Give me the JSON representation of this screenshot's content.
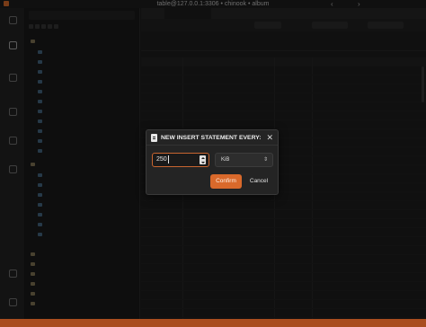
{
  "window": {
    "title": "table@127.0.0.1:3306 • chinook • album",
    "nav_back": "‹",
    "nav_forward": "›"
  },
  "dialog": {
    "title": "NEW INSERT STATEMENT EVERY:",
    "close_glyph": "✕",
    "value": "250",
    "unit": "KiB",
    "confirm_label": "Confirm",
    "cancel_label": "Cancel"
  },
  "colors": {
    "accent": "#d9692b",
    "statusbar": "#a94d1f"
  },
  "icons": [
    "app-icon",
    "file-export-icon",
    "close-icon",
    "stepper-icon",
    "chevron-down-icon"
  ]
}
